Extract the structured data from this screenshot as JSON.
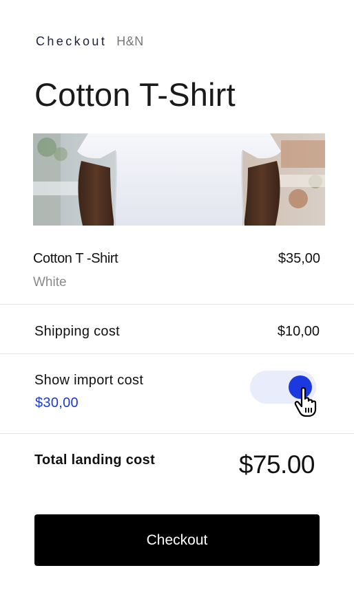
{
  "header": {
    "label": "Checkout",
    "brand": "H&N"
  },
  "product": {
    "title": "Cotton T-Shirt",
    "image": "white-tshirt-photo",
    "name": "Cotton T -Shirt",
    "variant": "White",
    "price": "$35,00"
  },
  "shipping": {
    "label": "Shipping cost",
    "value": "$10,00"
  },
  "import": {
    "label": "Show import cost",
    "value": "$30,00",
    "toggle_on": true
  },
  "total": {
    "label": "Total landing cost",
    "value": "$75.00"
  },
  "actions": {
    "checkout_label": "Checkout"
  },
  "colors": {
    "accent": "#1c39df",
    "toggle_track": "#e9ecfb",
    "button": "#000000"
  },
  "icons": {
    "cursor": "hand-pointer-icon"
  }
}
